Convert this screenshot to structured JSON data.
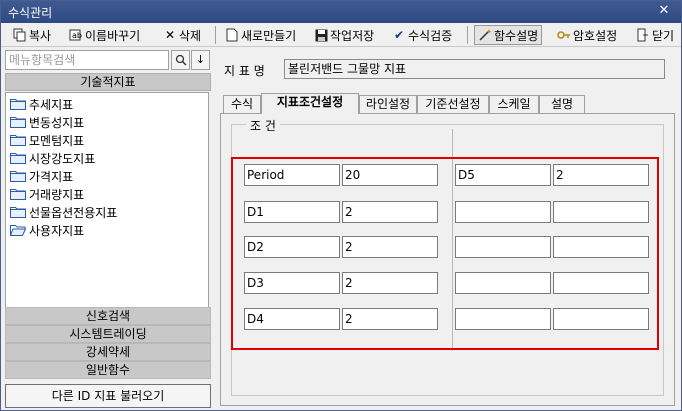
{
  "window": {
    "title": "수식관리",
    "close_glyph": "✕"
  },
  "toolbar": {
    "copy": "복사",
    "rename": "이름바꾸기",
    "delete": "삭제",
    "new": "새로만들기",
    "save": "작업저장",
    "verify": "수식검증",
    "func_help": "함수설명",
    "password": "암호설정",
    "close": "닫기"
  },
  "sidebar": {
    "search_placeholder": "메뉴항목검색",
    "header": "기술적지표",
    "items": [
      {
        "label": "추세지표"
      },
      {
        "label": "변동성지표"
      },
      {
        "label": "모멘텀지표"
      },
      {
        "label": "시장강도지표"
      },
      {
        "label": "가격지표"
      },
      {
        "label": "거래량지표"
      },
      {
        "label": "선물옵션전용지표"
      },
      {
        "label": "사용자지표"
      }
    ],
    "stack": [
      "신호검색",
      "시스템트레이딩",
      "강세약세",
      "일반함수"
    ],
    "bottom_button": "다른 ID 지표 불러오기"
  },
  "main": {
    "name_label": "지 표 명",
    "name_value": "볼린저밴드 그물망 지표",
    "tabs": [
      {
        "label": "수식"
      },
      {
        "label": "지표조건설정"
      },
      {
        "label": "라인설정"
      },
      {
        "label": "기준선설정"
      },
      {
        "label": "스케일"
      },
      {
        "label": "설명"
      }
    ],
    "condition_group_title": "조 건",
    "conditions_left": [
      {
        "name": "Period",
        "value": "20"
      },
      {
        "name": "D1",
        "value": "2"
      },
      {
        "name": "D2",
        "value": "2"
      },
      {
        "name": "D3",
        "value": "2"
      },
      {
        "name": "D4",
        "value": "2"
      }
    ],
    "conditions_right": [
      {
        "name": "D5",
        "value": "2"
      },
      {
        "name": "",
        "value": ""
      },
      {
        "name": "",
        "value": ""
      },
      {
        "name": "",
        "value": ""
      },
      {
        "name": "",
        "value": ""
      }
    ]
  },
  "colors": {
    "title_bar": "#3f5a91",
    "highlight": "#e00000",
    "panel": "#f0f0f0"
  }
}
